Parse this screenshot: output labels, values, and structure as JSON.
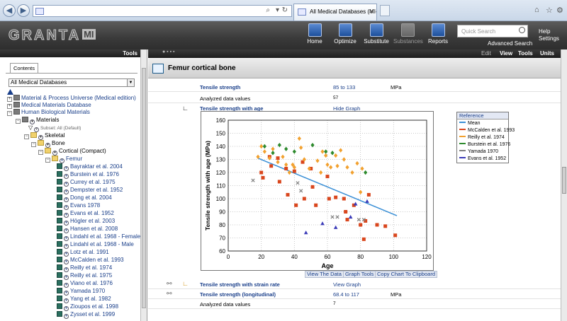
{
  "browser": {
    "address_text": "",
    "tab_title": "All Medical Databases (MI-...",
    "back_icon": "back-arrow-icon",
    "forward_icon": "forward-arrow-icon"
  },
  "app": {
    "logo_text": "GRANTA",
    "logo_suffix": "MI",
    "toolbar": [
      {
        "label": "Home",
        "icon": "home-icon",
        "enabled": true
      },
      {
        "label": "Optimize",
        "icon": "optimize-icon",
        "enabled": true
      },
      {
        "label": "Substitute",
        "icon": "substitute-icon",
        "enabled": true
      },
      {
        "label": "Substances",
        "icon": "substances-icon",
        "enabled": false
      },
      {
        "label": "Reports",
        "icon": "reports-icon",
        "enabled": true
      }
    ],
    "quick_search_placeholder": "Quick Search",
    "advanced_search": "Advanced Search",
    "help": "Help",
    "settings": "Settings"
  },
  "left_pane": {
    "tools_label": "Tools",
    "contents_tab": "Contents",
    "db_select": "All Medical Databases",
    "tree": [
      {
        "label": "Material & Process Universe (Medical edition)",
        "level": 0
      },
      {
        "label": "Medical Materials Database",
        "level": 0
      },
      {
        "label": "Human Biological Materials",
        "level": 0
      },
      {
        "label": "Materials",
        "level": 1
      },
      {
        "label": "Subset: All (Default)",
        "level": 2
      },
      {
        "label": "Skeletal",
        "level": 2
      },
      {
        "label": "Bone",
        "level": 3
      },
      {
        "label": "Cortical (Compact)",
        "level": 4
      },
      {
        "label": "Femur",
        "level": 5
      },
      {
        "label": "Bayraktar et al. 2004",
        "level": 6
      },
      {
        "label": "Burstein et al. 1976",
        "level": 6
      },
      {
        "label": "Currey et al. 1975",
        "level": 6
      },
      {
        "label": "Dempster et al. 1952",
        "level": 6
      },
      {
        "label": "Dong et al. 2004",
        "level": 6
      },
      {
        "label": "Evans 1978",
        "level": 6
      },
      {
        "label": "Evans et al. 1952",
        "level": 6
      },
      {
        "label": "Högler et al. 2003",
        "level": 6
      },
      {
        "label": "Hansen et al. 2008",
        "level": 6
      },
      {
        "label": "Lindahl et al. 1968 - Female",
        "level": 6
      },
      {
        "label": "Lindahl et al. 1968 - Male",
        "level": 6
      },
      {
        "label": "Lotz et al. 1991",
        "level": 6
      },
      {
        "label": "McCalden et al. 1993",
        "level": 6
      },
      {
        "label": "Reilly et al. 1974",
        "level": 6
      },
      {
        "label": "Reilly et al. 1975",
        "level": 6
      },
      {
        "label": "Viano et al. 1976",
        "level": 6
      },
      {
        "label": "Yamada 1970",
        "level": 6
      },
      {
        "label": "Yang et al. 1982",
        "level": 6
      },
      {
        "label": "Zioupos et al. 1998",
        "level": 6
      },
      {
        "label": "Zysset et al. 1999",
        "level": 6
      }
    ]
  },
  "right_pane": {
    "menu": [
      "Edit",
      "View",
      "Tools",
      "Units"
    ],
    "title": "Femur cortical bone",
    "rows": {
      "tensile_strength": {
        "name": "Tensile strength",
        "value": "85 to 133",
        "unit": "MPa"
      },
      "analyzed1": {
        "name": "Analyzed data values",
        "value": "57"
      },
      "tsa": {
        "name": "Tensile strength with age",
        "action": "Hide Graph"
      },
      "tssr": {
        "name": "Tensile strength with strain rate",
        "action": "View Graph"
      },
      "tsl": {
        "name": "Tensile strength (longitudinal)",
        "value": "68.4 to 117",
        "unit": "MPa"
      },
      "analyzed2": {
        "name": "Analyzed data values",
        "value": "7"
      }
    },
    "chart_buttons": [
      "View The Data",
      "Graph Tools",
      "Copy Chart To Clipboard"
    ]
  },
  "chart_data": {
    "type": "scatter",
    "title": "",
    "xlabel": "Age",
    "ylabel": "Tensile strength with age (MPa)",
    "xlim": [
      0,
      120
    ],
    "ylim": [
      60,
      160
    ],
    "xticks": [
      0,
      20,
      40,
      60,
      80,
      100,
      120
    ],
    "yticks": [
      60,
      70,
      80,
      90,
      100,
      110,
      120,
      130,
      140,
      150,
      160
    ],
    "grid": true,
    "legend": {
      "title": "Reference",
      "entries": [
        {
          "name": "Mean",
          "color": "#3a8fd6"
        },
        {
          "name": "McCalden et al. 1993",
          "color": "#d9461d"
        },
        {
          "name": "Reilly et al. 1974",
          "color": "#f2a12f"
        },
        {
          "name": "Burstein et al. 1976",
          "color": "#2e8a2e"
        },
        {
          "name": "Yamada 1970",
          "color": "#808080"
        },
        {
          "name": "Evans et al. 1952",
          "color": "#3b3bb8"
        }
      ]
    },
    "mean_line": [
      [
        18,
        131
      ],
      [
        102,
        87
      ]
    ],
    "series": [
      {
        "name": "McCalden et al. 1993",
        "marker": "square",
        "color": "#d9461d",
        "points": [
          [
            20,
            120
          ],
          [
            21,
            116
          ],
          [
            25,
            132
          ],
          [
            26,
            125
          ],
          [
            30,
            131
          ],
          [
            31,
            113
          ],
          [
            35,
            123
          ],
          [
            36,
            103
          ],
          [
            40,
            121
          ],
          [
            41,
            95
          ],
          [
            45,
            128
          ],
          [
            46,
            100
          ],
          [
            50,
            123
          ],
          [
            51,
            109
          ],
          [
            53,
            95
          ],
          [
            60,
            117
          ],
          [
            61,
            100
          ],
          [
            65,
            101
          ],
          [
            70,
            100
          ],
          [
            71,
            90
          ],
          [
            72,
            84
          ],
          [
            76,
            95
          ],
          [
            80,
            80
          ],
          [
            82,
            69
          ],
          [
            83,
            83
          ],
          [
            85,
            103
          ],
          [
            90,
            80
          ],
          [
            95,
            79
          ],
          [
            101,
            72
          ]
        ]
      },
      {
        "name": "Reilly et al. 1974",
        "marker": "diamond",
        "color": "#f2a12f",
        "points": [
          [
            18,
            132
          ],
          [
            20,
            140
          ],
          [
            22,
            136
          ],
          [
            25,
            131
          ],
          [
            27,
            138
          ],
          [
            30,
            128
          ],
          [
            33,
            132
          ],
          [
            35,
            126
          ],
          [
            37,
            120
          ],
          [
            39,
            126
          ],
          [
            40,
            124
          ],
          [
            43,
            146
          ],
          [
            44,
            139
          ],
          [
            46,
            130
          ],
          [
            49,
            123
          ],
          [
            54,
            129
          ],
          [
            56,
            120
          ],
          [
            57,
            136
          ],
          [
            59,
            133
          ],
          [
            60,
            126
          ],
          [
            62,
            124
          ],
          [
            65,
            133
          ],
          [
            66,
            125
          ],
          [
            68,
            137
          ],
          [
            70,
            130
          ],
          [
            72,
            124
          ],
          [
            75,
            120
          ],
          [
            78,
            127
          ],
          [
            80,
            105
          ],
          [
            81,
            123
          ]
        ]
      },
      {
        "name": "Burstein et al. 1976",
        "marker": "diamond",
        "color": "#2e8a2e",
        "points": [
          [
            22,
            140
          ],
          [
            27,
            135
          ],
          [
            31,
            141
          ],
          [
            35,
            138
          ],
          [
            40,
            136
          ],
          [
            51,
            141
          ],
          [
            59,
            136
          ],
          [
            63,
            135
          ],
          [
            83,
            120
          ]
        ]
      },
      {
        "name": "Yamada 1970",
        "marker": "x",
        "color": "#808080",
        "points": [
          [
            15,
            114
          ],
          [
            42,
            112
          ],
          [
            44,
            106
          ],
          [
            63,
            86
          ],
          [
            66,
            86
          ],
          [
            79,
            84
          ],
          [
            82,
            84
          ]
        ]
      },
      {
        "name": "Evans et al. 1952",
        "marker": "triangle",
        "color": "#3b3bb8",
        "points": [
          [
            47,
            74
          ],
          [
            57,
            81
          ],
          [
            65,
            78
          ],
          [
            74,
            86
          ],
          [
            77,
            96
          ],
          [
            84,
            98
          ]
        ]
      }
    ]
  }
}
